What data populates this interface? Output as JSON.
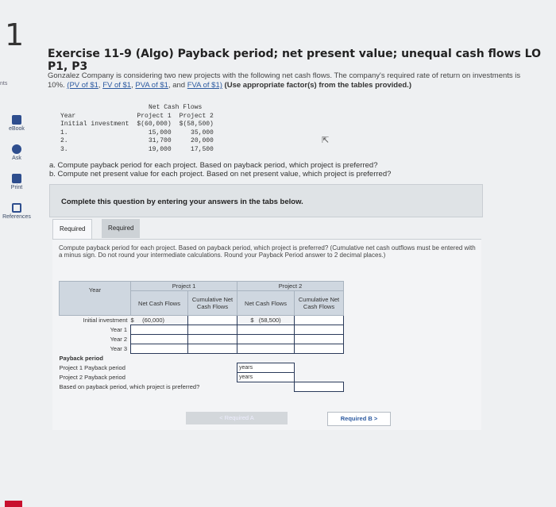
{
  "page": {
    "number": "1",
    "points_label": "nts"
  },
  "rail": {
    "ebook": "eBook",
    "ask": "Ask",
    "print": "Print",
    "references": "References"
  },
  "title": "Exercise 11-9 (Algo) Payback period; net present value; unequal cash flows LO P1, P3",
  "intro": {
    "text_a": "Gonzalez Company is considering two new projects with the following net cash flows. The company's required rate of return on investments is 10%. ",
    "link_pv": "(PV of $1",
    "link_fv": "FV of $1",
    "link_pva": "PVA of $1",
    "link_fva": "FVA of $1)",
    "sep1": ", ",
    "sep2": ", ",
    "sep3": ", and ",
    "bold": " (Use appropriate factor(s) from the tables provided.)"
  },
  "cashflows": {
    "header": "Net Cash Flows",
    "col1": "Project 1",
    "col2": "Project 2",
    "year_label": "Year",
    "rows": [
      {
        "label": "Initial investment",
        "p1": "$(60,000)",
        "p2": "$(58,500)"
      },
      {
        "label": "1.",
        "p1": "15,000",
        "p2": "35,000"
      },
      {
        "label": "2.",
        "p1": "31,700",
        "p2": "20,000"
      },
      {
        "label": "3.",
        "p1": "19,000",
        "p2": "17,500"
      }
    ]
  },
  "questions": {
    "a": "a. Compute payback period for each project. Based on payback period, which project is preferred?",
    "b": "b. Compute net present value for each project. Based on net present value, which project is preferred?"
  },
  "banner": "Complete this question by entering your answers in the tabs below.",
  "tabs": {
    "a": "Required A",
    "b": "Required B"
  },
  "instructions": "Compute payback period for each project. Based on payback period, which project is preferred? (Cumulative net cash outflows must be entered with a minus sign. Do not round your intermediate calculations. Round your Payback Period answer to 2 decimal places.)",
  "grid": {
    "project1": "Project 1",
    "project2": "Project 2",
    "year": "Year",
    "ncf": "Net Cash Flows",
    "cum": "Cumulative Net Cash Flows",
    "ncf2": "Net Cash Flows",
    "cum2": "Cumulative Net Cash Flows",
    "dollar": "$",
    "init_label": "Initial investment",
    "p1_init": "(60,000)",
    "p2_init": "(58,500)",
    "year1": "Year 1",
    "year2": "Year 2",
    "year3": "Year 3",
    "payback": "Payback period",
    "p1_payback": "Project 1 Payback period",
    "p2_payback": "Project 2 Payback period",
    "years": "years",
    "preferred": "Based on payback period, which project is preferred?"
  },
  "nav": {
    "prev": "< Required A",
    "next": "Required B >"
  }
}
